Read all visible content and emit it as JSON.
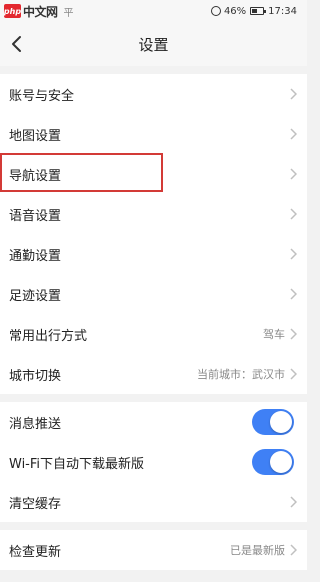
{
  "statusbar": {
    "watermark_badge": "php",
    "watermark_text": "中文网",
    "watermark_trailing": "平",
    "battery_percent": "46%",
    "time": "17:34"
  },
  "header": {
    "title": "设置"
  },
  "group1": {
    "items": [
      {
        "label": "账号与安全"
      },
      {
        "label": "地图设置"
      },
      {
        "label": "导航设置"
      },
      {
        "label": "语音设置"
      },
      {
        "label": "通勤设置"
      },
      {
        "label": "足迹设置"
      },
      {
        "label": "常用出行方式",
        "value": "驾车"
      },
      {
        "label": "城市切换",
        "value": "当前城市：武汉市"
      }
    ]
  },
  "group2": {
    "items": [
      {
        "label": "消息推送",
        "toggle_on": true
      },
      {
        "label": "Wi-Fi下自动下载最新版",
        "toggle_on": true
      },
      {
        "label": "清空缓存"
      }
    ]
  },
  "group3": {
    "items": [
      {
        "label": "检查更新",
        "value": "已是最新版"
      }
    ]
  },
  "colors": {
    "toggle_on": "#3f80f5",
    "highlight": "#d33a36"
  }
}
